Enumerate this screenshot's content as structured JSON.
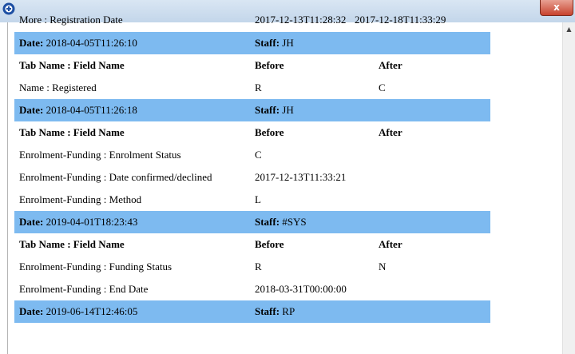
{
  "window": {
    "close_glyph": "x"
  },
  "top_row": {
    "field": "More : Registration Date",
    "before": "2017-12-13T11:28:32",
    "after": "2017-12-18T11:33:29"
  },
  "labels": {
    "date": "Date:",
    "staff": "Staff:",
    "tab_field": "Tab Name : Field Name",
    "before": "Before",
    "after": "After"
  },
  "groups": [
    {
      "date": "2018-04-05T11:26:10",
      "staff": "JH",
      "rows": [
        {
          "field": "Name : Registered",
          "before": "R",
          "after": "C"
        }
      ]
    },
    {
      "date": "2018-04-05T11:26:18",
      "staff": "JH",
      "rows": [
        {
          "field": "Enrolment-Funding : Enrolment Status",
          "before": "C",
          "after": ""
        },
        {
          "field": "Enrolment-Funding : Date confirmed/declined",
          "before": "2017-12-13T11:33:21",
          "after": ""
        },
        {
          "field": "Enrolment-Funding : Method",
          "before": "L",
          "after": ""
        }
      ]
    },
    {
      "date": "2019-04-01T18:23:43",
      "staff": "#SYS",
      "rows": [
        {
          "field": "Enrolment-Funding : Funding Status",
          "before": "R",
          "after": "N"
        },
        {
          "field": "Enrolment-Funding : End Date",
          "before": "2018-03-31T00:00:00",
          "after": ""
        }
      ]
    },
    {
      "date": "2019-06-14T12:46:05",
      "staff": "RP",
      "rows": []
    }
  ]
}
